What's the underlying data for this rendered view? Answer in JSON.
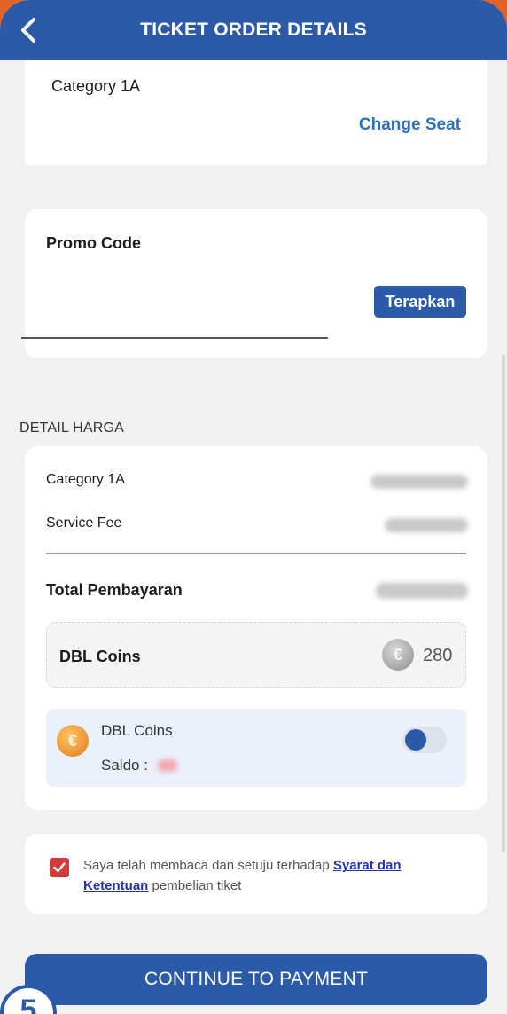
{
  "header": {
    "title": "TICKET ORDER DETAILS",
    "back_icon": "chevron-left-icon"
  },
  "seat": {
    "category": "Category 1A",
    "change_seat_label": "Change Seat"
  },
  "promo": {
    "label": "Promo Code",
    "input_value": "",
    "placeholder": "",
    "apply_label": "Terapkan"
  },
  "price_detail": {
    "section_label": "DETAIL HARGA",
    "rows": [
      {
        "label": "Category 1A",
        "amount_hidden": true
      },
      {
        "label": "Service Fee",
        "amount_hidden": true
      }
    ],
    "total_label": "Total Pembayaran"
  },
  "coins": {
    "label": "DBL Coins",
    "value": "280",
    "use_title": "DBL Coins",
    "saldo_label": "Saldo :",
    "toggle_on": false
  },
  "terms": {
    "prefix": "Saya telah membaca dan setuju terhadap ",
    "link": "Syarat dan Ketentuan",
    "suffix": " pembelian tiket",
    "checked": true
  },
  "footer": {
    "continue_label": "CONTINUE TO PAYMENT",
    "step_number": "5"
  },
  "colors": {
    "primary": "#2b5aa8",
    "link": "#2d71bf",
    "accent_orange": "#e0632a",
    "checkbox_red": "#d33a3a"
  }
}
